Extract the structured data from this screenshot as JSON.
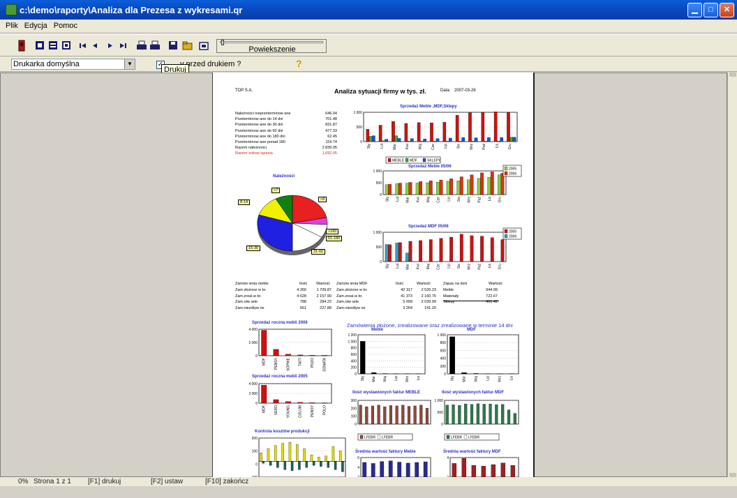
{
  "window": {
    "title": "c:\\demo\\raporty\\Analiza dla Prezesa z wykresami.qr",
    "min_symbol": "▁",
    "max_symbol": "□",
    "close_symbol": "✕"
  },
  "menu": [
    "Plik",
    "Edycja",
    "Pomoc"
  ],
  "toolbar": {
    "zoom_label": "Powiekszenie",
    "printer_select": "Drukarka domyślna",
    "checkbox_label": "v przed drukiem ?",
    "tooltip": "Drukuj",
    "help_symbol": "?",
    "icons": [
      "exit-icon",
      "single-page-icon",
      "two-pages-icon",
      "multi-page-icon",
      "first-page-icon",
      "prev-page-icon",
      "next-page-icon",
      "last-page-icon",
      "print-icon",
      "print-setup-icon",
      "save-icon",
      "open-icon",
      "export-icon"
    ]
  },
  "report": {
    "company": "TOP S.A.",
    "title": "Analiza sytuacji firmy w tys. zł.",
    "date_label": "Data:",
    "date": "2007-03-26",
    "receivables": [
      {
        "label": "Należności nieprzeterminow ane",
        "value": "646.04"
      },
      {
        "label": "Przeterminow ane do 14 dni",
        "value": "701.48"
      },
      {
        "label": "Przeterminow ane do 30 dni",
        "value": "831.87"
      },
      {
        "label": "Przeterminow ane do 60 dni",
        "value": "477.33"
      },
      {
        "label": "Przeterminow ane do 180 dni",
        "value": "62.45"
      },
      {
        "label": "Przeterminow ane ponad 180",
        "value": "119.74"
      },
      {
        "label": "Razem należności",
        "value": "2 839.05"
      },
      {
        "label": "Razem zobow iązania",
        "value": "1,692.05"
      }
    ],
    "pie_title": "Należności",
    "pie_labels": [
      "<7",
      "<6",
      "8-14",
      ">180",
      "51-180",
      "15-30",
      "31-60"
    ],
    "orders_headers": [
      "Zamów ienia meble",
      "Ilość",
      "Wartość",
      "Zamów ienia MDF",
      "Ilość",
      "Wartość",
      "Zapas na dziś",
      "Wartość"
    ],
    "orders_meble": [
      [
        "Zam.złożone w br.",
        "4 266",
        "1 709.87"
      ],
      [
        "Zam.zreal.w br.",
        "4 628",
        "2 157.90"
      ],
      [
        "Zam.otw arte",
        "788",
        "284.22"
      ],
      [
        "Zam.niezdtyw ne",
        "561",
        "227.88"
      ]
    ],
    "orders_mdf": [
      [
        "Zam.złożone w br.",
        "42 317",
        "2 526.23"
      ],
      [
        "Zam.zreal.w br.",
        "41 373",
        "2 160.75"
      ],
      [
        "Zam.otw arte",
        "5 658",
        "2 039.99"
      ],
      [
        "Zam.niezdtyw ne",
        "3 264",
        "141.20"
      ]
    ],
    "stock": [
      [
        "Meble",
        "944.99"
      ],
      [
        "Materiały",
        "722.67"
      ],
      [
        "Sklepy",
        "461.42"
      ]
    ],
    "chart_titles": {
      "c1": "Sprzedaż Meble ,MDF,Sklepy",
      "c2": "Sprzedaż Meble 05/06",
      "c3": "Sprzedaż MDF 05/06",
      "c4": "Sprzedaż roczna mebli 2006",
      "c5": "Sprzedaż roczna mebli 2005",
      "c6": "Kontrola kosztów produkcji",
      "c7": "Zamówienia złożone, zrealizowane oraz zrealizowane w terminie 14 dni",
      "c7a": "Meble",
      "c7b": "MDF",
      "c8": "Ilość wystawionych faktur MEBLE",
      "c9": "Ilość wystawionych faktur MDF",
      "c10": "Średnia wartość faktury Meble",
      "c11": "Średnia wartość faktury MDF"
    },
    "c1_legend": [
      "MEBLE",
      "MDF",
      "SKLEPY"
    ],
    "c2_legend": [
      "2005",
      "2006"
    ],
    "c3_legend": [
      "2005",
      "2006"
    ],
    "c8_legend": [
      "LFEBR",
      "LFEBR"
    ],
    "c9_legend": [
      "LFEBR",
      "LFEBR"
    ],
    "c1_yticks": [
      "1 000",
      "500",
      "0"
    ],
    "c2_yticks": [
      "1 000",
      "500",
      "0"
    ],
    "c3_yticks": [
      "1 000",
      "500",
      "0"
    ],
    "c4_yticks": [
      "4 000",
      "2 000",
      "0"
    ],
    "c5_yticks": [
      "4 000",
      "2 000",
      "0"
    ],
    "c6_yticks": [
      "200",
      "100",
      "0",
      "-100"
    ],
    "c7a_yticks": [
      "1 200",
      "1 000",
      "800",
      "600",
      "400",
      "200",
      "0"
    ],
    "c7b_yticks": [
      "1 000",
      "800",
      "600",
      "400",
      "200",
      "0"
    ],
    "c8_yticks": [
      "300",
      "200",
      "100",
      "0"
    ],
    "c9_yticks": [
      "1 000",
      "500",
      "0"
    ],
    "c10_yticks": [
      "6",
      "4",
      "2"
    ],
    "c11_yticks": [
      "4",
      "2"
    ],
    "months_short": [
      "Sty",
      "Lut",
      "Mar",
      "Kwi",
      "Maj",
      "Cze",
      "Lip",
      "Sie",
      "Wrz",
      "Paź",
      "Lis",
      "Gru"
    ],
    "c4_cats": [
      "MDF",
      "PENSY",
      "SOPHIE",
      "TAITI",
      "POZO",
      "SONATA"
    ],
    "c5_cats": [
      "MDF",
      "VERO",
      "YOUNG",
      "COLUM",
      "PENSY",
      "POLO"
    ],
    "c7_cats": [
      "Sty",
      "Mar",
      "Maj",
      "Lip",
      "Wrz",
      "Lis"
    ]
  },
  "chart_data": [
    {
      "type": "bar",
      "title": "Sprzedaż Meble ,MDF,Sklepy",
      "categories": [
        "Sty",
        "Lut",
        "Mar",
        "Kwi",
        "Maj",
        "Cze",
        "Lip",
        "Sie",
        "Wrz",
        "Paź",
        "Lis",
        "Gru"
      ],
      "ylim": [
        0,
        1000
      ],
      "series": [
        {
          "name": "MEBLE",
          "values": [
            420,
            560,
            690,
            620,
            650,
            640,
            660,
            900,
            980,
            1000,
            1020,
            990
          ]
        },
        {
          "name": "MDF",
          "values": [
            180,
            30,
            200,
            20,
            20,
            20,
            20,
            20,
            20,
            20,
            20,
            150
          ]
        },
        {
          "name": "SKLEPY",
          "values": [
            200,
            80,
            110,
            100,
            90,
            100,
            120,
            140,
            130,
            140,
            140,
            150
          ]
        }
      ]
    },
    {
      "type": "bar",
      "title": "Sprzedaż Meble 05/06",
      "categories": [
        "Sty",
        "Lut",
        "Mar",
        "Kwi",
        "Maj",
        "Cze",
        "Lip",
        "Sie",
        "Wrz",
        "Paź",
        "Lis",
        "Gru"
      ],
      "ylim": [
        0,
        1200
      ],
      "series": [
        {
          "name": "2005",
          "values": [
            500,
            550,
            570,
            580,
            600,
            630,
            680,
            700,
            750,
            820,
            880,
            1000
          ]
        },
        {
          "name": "2006",
          "values": [
            520,
            580,
            620,
            660,
            700,
            740,
            800,
            900,
            1000,
            1100,
            1150,
            1080
          ]
        }
      ]
    },
    {
      "type": "bar",
      "title": "Sprzedaż MDF 05/06",
      "categories": [
        "Sty",
        "Lut",
        "Mar",
        "Kwi",
        "Maj",
        "Cze",
        "Lip",
        "Sie",
        "Wrz",
        "Paź",
        "Lis",
        "Gru"
      ],
      "ylim": [
        0,
        1200
      ],
      "series": [
        {
          "name": "2005",
          "values": [
            700,
            760,
            350,
            0,
            0,
            0,
            0,
            0,
            0,
            0,
            0,
            0
          ]
        },
        {
          "name": "2006",
          "values": [
            690,
            780,
            830,
            860,
            900,
            950,
            1000,
            1120,
            1060,
            1040,
            980,
            900
          ]
        }
      ]
    },
    {
      "type": "bar",
      "title": "Sprzedaż roczna mebli 2006",
      "categories": [
        "MDF",
        "PENSY",
        "SOPHIE",
        "TAITI",
        "POZO",
        "SONATA"
      ],
      "ylim": [
        0,
        5000
      ],
      "series": [
        {
          "name": "",
          "values": [
            4800,
            1200,
            300,
            150,
            100,
            80
          ]
        }
      ]
    },
    {
      "type": "bar",
      "title": "Sprzedaż roczna mebli 2005",
      "categories": [
        "MDF",
        "VERO",
        "YOUNG",
        "COLUM",
        "PENSY",
        "POLO"
      ],
      "ylim": [
        0,
        5000
      ],
      "series": [
        {
          "name": "",
          "values": [
            4600,
            900,
            400,
            200,
            120,
            90
          ]
        }
      ]
    },
    {
      "type": "bar",
      "title": "Kontrola kosztów produkcji",
      "ylim": [
        -150,
        220
      ],
      "series": [
        {
          "name": "",
          "values": [
            80,
            120,
            150,
            170,
            180,
            160,
            120,
            60,
            40,
            50,
            140,
            100
          ]
        },
        {
          "name": "",
          "values": [
            -20,
            -40,
            -60,
            -80,
            -90,
            -80,
            -60,
            -40,
            -50,
            -60,
            -80,
            -100
          ]
        }
      ]
    },
    {
      "type": "bar",
      "title": "Meble",
      "ylim": [
        0,
        1200
      ],
      "series": [
        {
          "name": "",
          "values": [
            1000,
            40,
            10,
            5,
            5,
            5
          ]
        }
      ]
    },
    {
      "type": "bar",
      "title": "MDF",
      "ylim": [
        0,
        1000
      ],
      "series": [
        {
          "name": "",
          "values": [
            950,
            30,
            10,
            5,
            5,
            5
          ]
        }
      ]
    },
    {
      "type": "bar",
      "title": "Ilość wystawionych faktur MEBLE",
      "ylim": [
        0,
        300
      ],
      "series": [
        {
          "name": "LFEBR",
          "values": [
            240,
            220,
            230,
            240,
            220,
            235,
            230,
            240,
            225,
            230,
            240,
            200
          ]
        }
      ]
    },
    {
      "type": "bar",
      "title": "Ilość wystawionych faktur MDF",
      "ylim": [
        0,
        1000
      ],
      "series": [
        {
          "name": "LFEBR",
          "values": [
            800,
            820,
            790,
            850,
            830,
            860,
            840,
            850,
            820,
            830,
            600,
            450
          ]
        }
      ]
    },
    {
      "type": "bar",
      "title": "Średnia wartość faktury Meble",
      "ylim": [
        0,
        6
      ],
      "series": [
        {
          "name": "",
          "values": [
            4.5,
            4.2,
            4.8,
            5.0,
            4.6,
            4.3,
            4.5,
            4.7
          ]
        }
      ]
    },
    {
      "type": "bar",
      "title": "Średnia wartość faktury MDF",
      "ylim": [
        0,
        5
      ],
      "series": [
        {
          "name": "",
          "values": [
            3.5,
            4.8,
            3.0,
            2.8,
            3.2,
            3.6,
            3.0
          ]
        }
      ]
    }
  ],
  "status": {
    "progress": "0%",
    "page": "Strona 1 z 1",
    "f1": "[F1] drukuj",
    "f2": "[F2] ustaw",
    "f10": "[F10] zakończ"
  }
}
